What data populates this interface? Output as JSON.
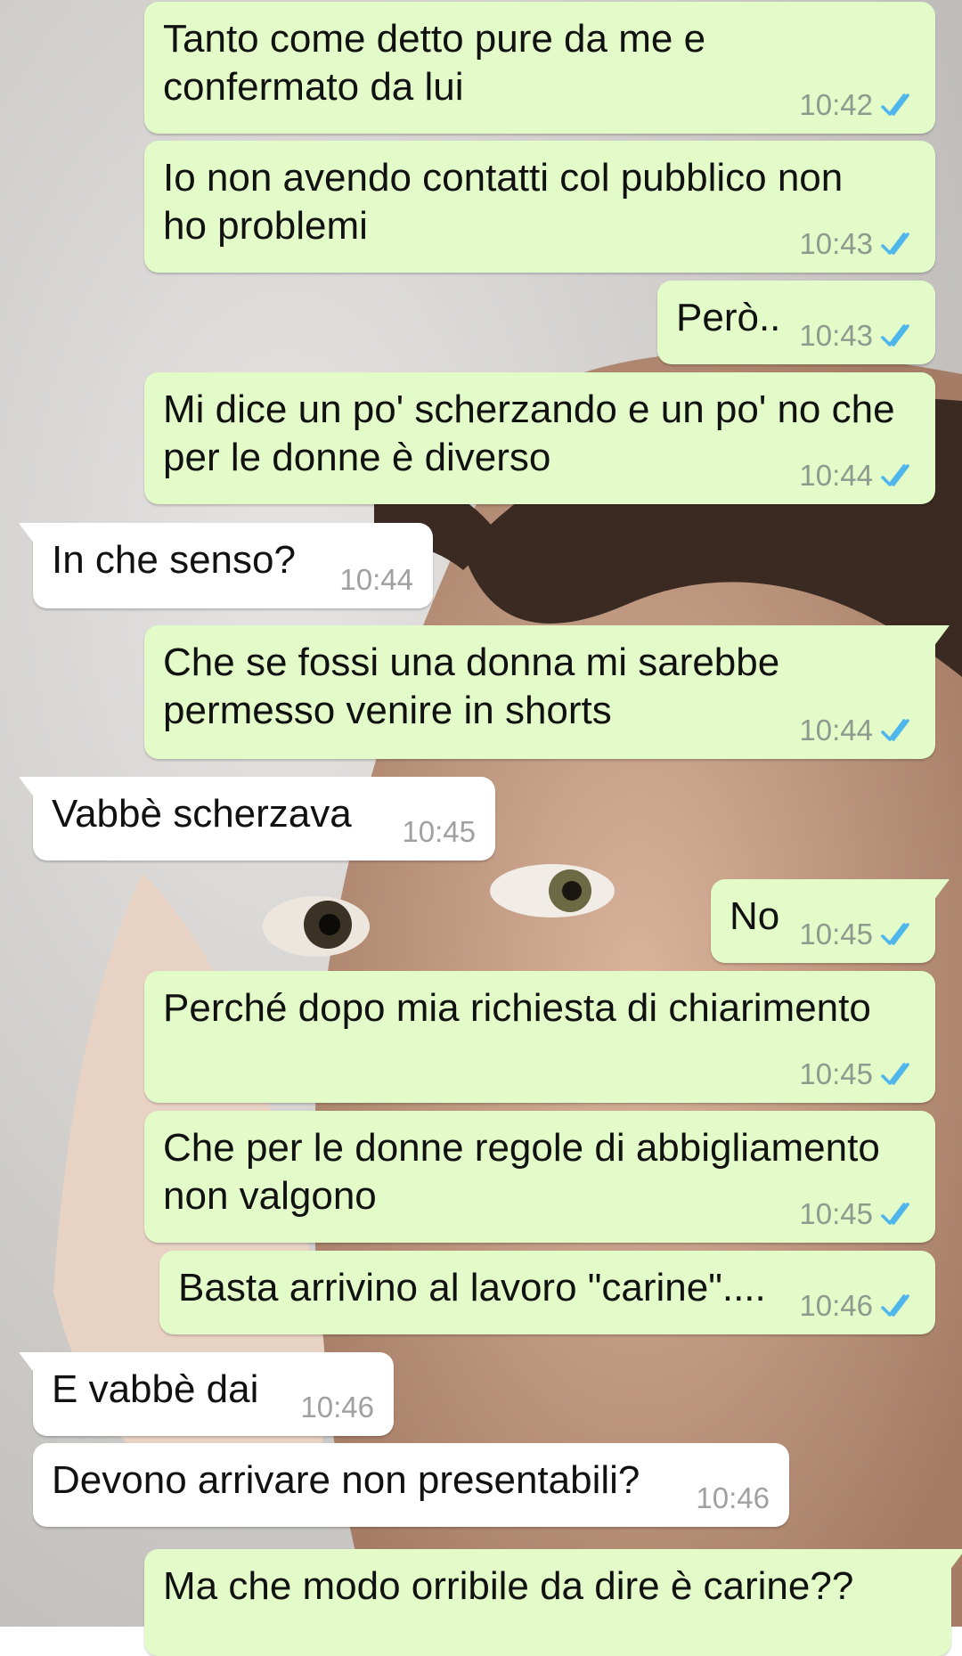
{
  "theme": {
    "outgoing_bubble": "#e2fbc9",
    "incoming_bubble": "#ffffff",
    "tick_color": "#4fb6ec"
  },
  "messages": [
    {
      "dir": "out",
      "lines": [
        "Tanto come detto pure da me e",
        "confermato da lui"
      ],
      "time": "10:42",
      "status_icon": "double-check-icon"
    },
    {
      "dir": "out",
      "lines": [
        "Io non avendo contatti col pubblico non",
        "ho problemi"
      ],
      "time": "10:43",
      "status_icon": "double-check-icon"
    },
    {
      "dir": "out",
      "lines": [
        "Però.."
      ],
      "time": "10:43",
      "status_icon": "double-check-icon"
    },
    {
      "dir": "out",
      "lines": [
        "Mi dice un po' scherzando e un po' no che",
        "per le donne è diverso"
      ],
      "time": "10:44",
      "status_icon": "double-check-icon"
    },
    {
      "dir": "in",
      "lines": [
        "In che senso?"
      ],
      "time": "10:44"
    },
    {
      "dir": "out",
      "lines": [
        "Che se fossi una donna mi sarebbe",
        "permesso venire in shorts"
      ],
      "time": "10:44",
      "status_icon": "double-check-icon"
    },
    {
      "dir": "in",
      "lines": [
        "Vabbè scherzava"
      ],
      "time": "10:45"
    },
    {
      "dir": "out",
      "lines": [
        "No"
      ],
      "time": "10:45",
      "status_icon": "double-check-icon"
    },
    {
      "dir": "out",
      "lines": [
        "Perché dopo mia richiesta di chiarimento"
      ],
      "time": "10:45",
      "status_icon": "double-check-icon"
    },
    {
      "dir": "out",
      "lines": [
        "Che per le donne regole di abbigliamento",
        "non valgono"
      ],
      "time": "10:45",
      "status_icon": "double-check-icon"
    },
    {
      "dir": "out",
      "lines": [
        "Basta arrivino al lavoro \"carine\"...."
      ],
      "time": "10:46",
      "status_icon": "double-check-icon"
    },
    {
      "dir": "in",
      "lines": [
        "E vabbè dai"
      ],
      "time": "10:46"
    },
    {
      "dir": "in",
      "lines": [
        "Devono arrivare non presentabili?"
      ],
      "time": "10:46"
    },
    {
      "dir": "out",
      "lines": [
        "Ma che modo orribile da dire è carine??"
      ],
      "time": "",
      "status_icon": ""
    }
  ]
}
